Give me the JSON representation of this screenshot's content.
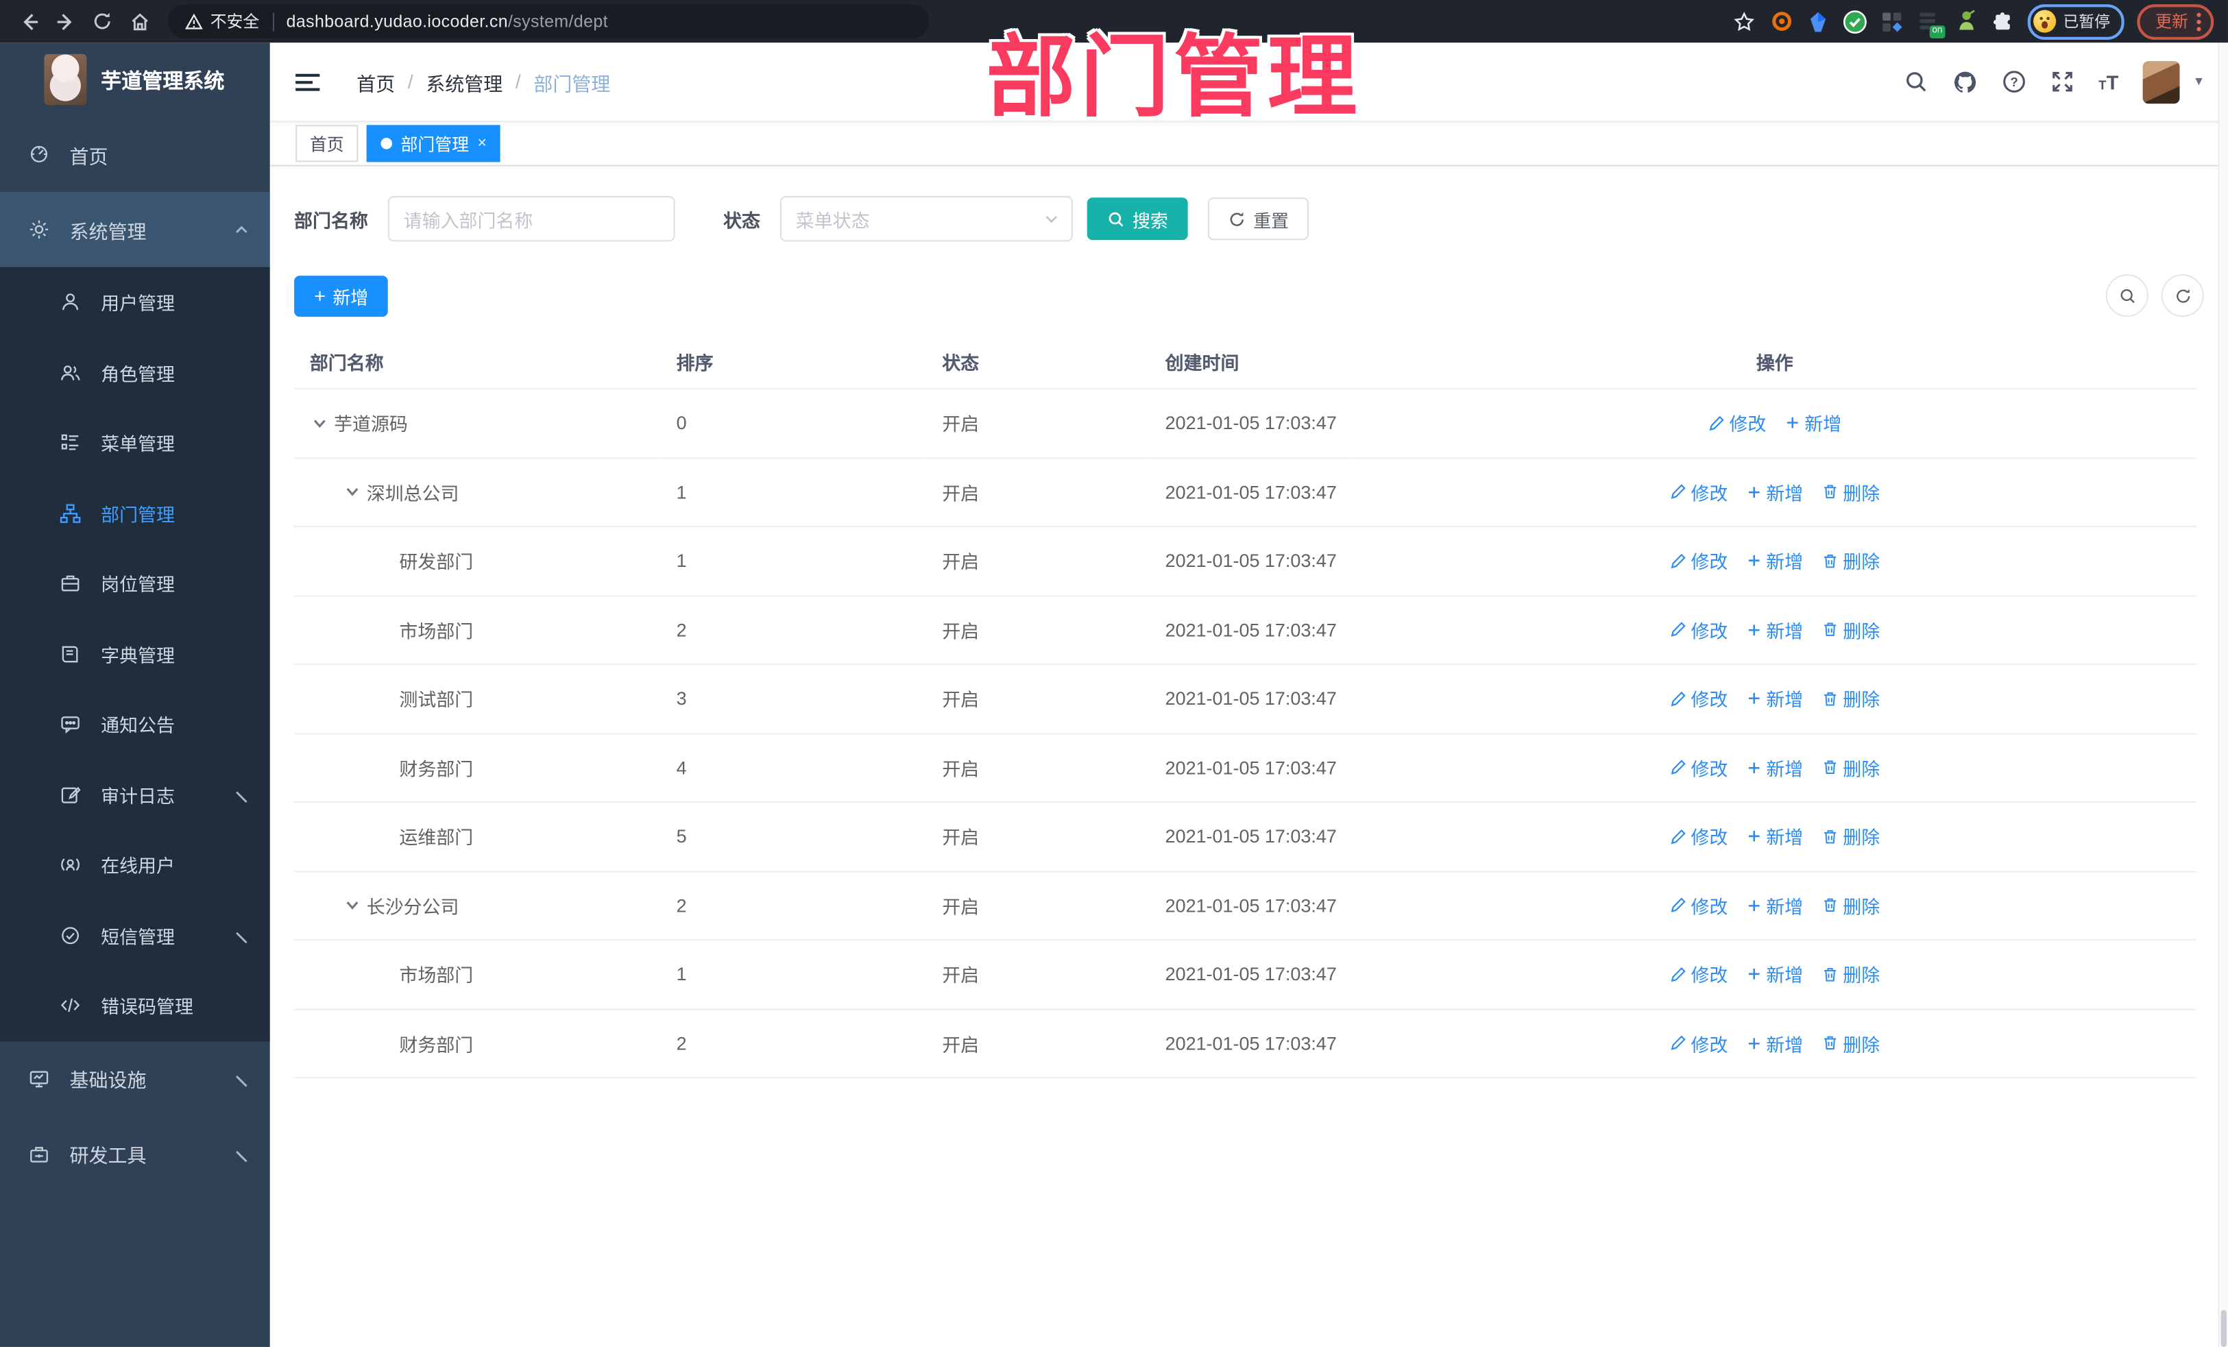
{
  "browser": {
    "security_label": "不安全",
    "url_host": "dashboard.yudao.iocoder.cn",
    "url_path": "/system/dept",
    "paused_badge": "已暂停",
    "update_label": "更新"
  },
  "overlay_title": "部门管理",
  "sidebar": {
    "app_title": "芋道管理系统",
    "items": [
      {
        "label": "首页",
        "icon": "dashboard-icon",
        "type": "top"
      },
      {
        "label": "系统管理",
        "icon": "gear-icon",
        "type": "top",
        "chevron": "up",
        "highlight": true
      },
      {
        "label": "用户管理",
        "icon": "user-icon",
        "type": "sub"
      },
      {
        "label": "角色管理",
        "icon": "users-icon",
        "type": "sub"
      },
      {
        "label": "菜单管理",
        "icon": "menu-list-icon",
        "type": "sub"
      },
      {
        "label": "部门管理",
        "icon": "org-tree-icon",
        "type": "sub",
        "active": true
      },
      {
        "label": "岗位管理",
        "icon": "briefcase-icon",
        "type": "sub"
      },
      {
        "label": "字典管理",
        "icon": "dictionary-icon",
        "type": "sub"
      },
      {
        "label": "通知公告",
        "icon": "announcement-icon",
        "type": "sub"
      },
      {
        "label": "审计日志",
        "icon": "audit-log-icon",
        "type": "sub",
        "chevron": "down"
      },
      {
        "label": "在线用户",
        "icon": "online-user-icon",
        "type": "sub"
      },
      {
        "label": "短信管理",
        "icon": "sms-icon",
        "type": "sub",
        "chevron": "down"
      },
      {
        "label": "错误码管理",
        "icon": "error-code-icon",
        "type": "sub"
      },
      {
        "label": "基础设施",
        "icon": "infrastructure-icon",
        "type": "top",
        "chevron": "down"
      },
      {
        "label": "研发工具",
        "icon": "devtools-icon",
        "type": "top",
        "chevron": "down"
      }
    ]
  },
  "header": {
    "breadcrumb": [
      {
        "label": "首页"
      },
      {
        "label": "系统管理"
      },
      {
        "label": "部门管理",
        "current": true
      }
    ]
  },
  "tabs": [
    {
      "label": "首页",
      "active": false
    },
    {
      "label": "部门管理",
      "active": true,
      "closable": true
    }
  ],
  "filters": {
    "name_label": "部门名称",
    "name_placeholder": "请输入部门名称",
    "status_label": "状态",
    "status_placeholder": "菜单状态",
    "search_label": "搜索",
    "reset_label": "重置"
  },
  "toolbar": {
    "add_label": "新增"
  },
  "table": {
    "columns": [
      "部门名称",
      "排序",
      "状态",
      "创建时间",
      "操作"
    ],
    "action_labels": {
      "edit": "修改",
      "add": "新增",
      "delete": "删除"
    },
    "rows": [
      {
        "name": "芋道源码",
        "level": 0,
        "expanded": true,
        "sort": "0",
        "status": "开启",
        "created": "2021-01-05 17:03:47",
        "actions": [
          "edit",
          "add"
        ]
      },
      {
        "name": "深圳总公司",
        "level": 1,
        "expanded": true,
        "sort": "1",
        "status": "开启",
        "created": "2021-01-05 17:03:47",
        "actions": [
          "edit",
          "add",
          "delete"
        ]
      },
      {
        "name": "研发部门",
        "level": 2,
        "expanded": false,
        "sort": "1",
        "status": "开启",
        "created": "2021-01-05 17:03:47",
        "actions": [
          "edit",
          "add",
          "delete"
        ]
      },
      {
        "name": "市场部门",
        "level": 2,
        "expanded": false,
        "sort": "2",
        "status": "开启",
        "created": "2021-01-05 17:03:47",
        "actions": [
          "edit",
          "add",
          "delete"
        ]
      },
      {
        "name": "测试部门",
        "level": 2,
        "expanded": false,
        "sort": "3",
        "status": "开启",
        "created": "2021-01-05 17:03:47",
        "actions": [
          "edit",
          "add",
          "delete"
        ]
      },
      {
        "name": "财务部门",
        "level": 2,
        "expanded": false,
        "sort": "4",
        "status": "开启",
        "created": "2021-01-05 17:03:47",
        "actions": [
          "edit",
          "add",
          "delete"
        ]
      },
      {
        "name": "运维部门",
        "level": 2,
        "expanded": false,
        "sort": "5",
        "status": "开启",
        "created": "2021-01-05 17:03:47",
        "actions": [
          "edit",
          "add",
          "delete"
        ]
      },
      {
        "name": "长沙分公司",
        "level": 1,
        "expanded": true,
        "sort": "2",
        "status": "开启",
        "created": "2021-01-05 17:03:47",
        "actions": [
          "edit",
          "add",
          "delete"
        ]
      },
      {
        "name": "市场部门",
        "level": 2,
        "expanded": false,
        "sort": "1",
        "status": "开启",
        "created": "2021-01-05 17:03:47",
        "actions": [
          "edit",
          "add",
          "delete"
        ]
      },
      {
        "name": "财务部门",
        "level": 2,
        "expanded": false,
        "sort": "2",
        "status": "开启",
        "created": "2021-01-05 17:03:47",
        "actions": [
          "edit",
          "add",
          "delete"
        ]
      }
    ]
  },
  "colors": {
    "primary_blue": "#1890ff",
    "search_teal": "#17b3aa",
    "overlay_pink": "#fb3a5f",
    "sidebar_bg": "#304156",
    "submenu_bg": "#1f2d3d",
    "active_menu": "#409eff",
    "link_blue": "#2d8cf0"
  }
}
